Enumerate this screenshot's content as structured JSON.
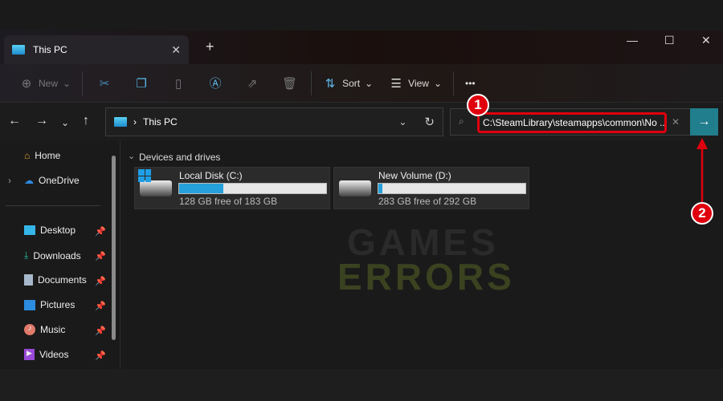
{
  "tab": {
    "title": "This PC",
    "close": "✕",
    "new_tab": "+"
  },
  "window": {
    "minimize": "—",
    "maximize": "☐",
    "close": "✕"
  },
  "toolbar": {
    "new": "New",
    "sort": "Sort",
    "view": "View",
    "more": "•••"
  },
  "address": {
    "location": "This PC"
  },
  "search": {
    "path_value": "C:\\SteamLibrary\\steamapps\\common\\No ...",
    "clear": "✕",
    "go": "→"
  },
  "annotations": {
    "step1": "1",
    "step2": "2"
  },
  "sidebar": {
    "items": [
      {
        "label": "Home"
      },
      {
        "label": "OneDrive"
      },
      {
        "label": "Desktop"
      },
      {
        "label": "Downloads"
      },
      {
        "label": "Documents"
      },
      {
        "label": "Pictures"
      },
      {
        "label": "Music"
      },
      {
        "label": "Videos"
      }
    ]
  },
  "main": {
    "section": "Devices and drives",
    "drives": [
      {
        "name": "Local Disk (C:)",
        "info": "128 GB free of 183 GB",
        "used_fraction": 0.3
      },
      {
        "name": "New Volume (D:)",
        "info": "283 GB free of 292 GB",
        "used_fraction": 0.03
      }
    ]
  },
  "watermark": {
    "line1": "GAMES",
    "line2": "ERRORS"
  },
  "colors": {
    "accent": "#26a0da",
    "go_button": "#217e8c",
    "annotation": "#e0000d"
  }
}
